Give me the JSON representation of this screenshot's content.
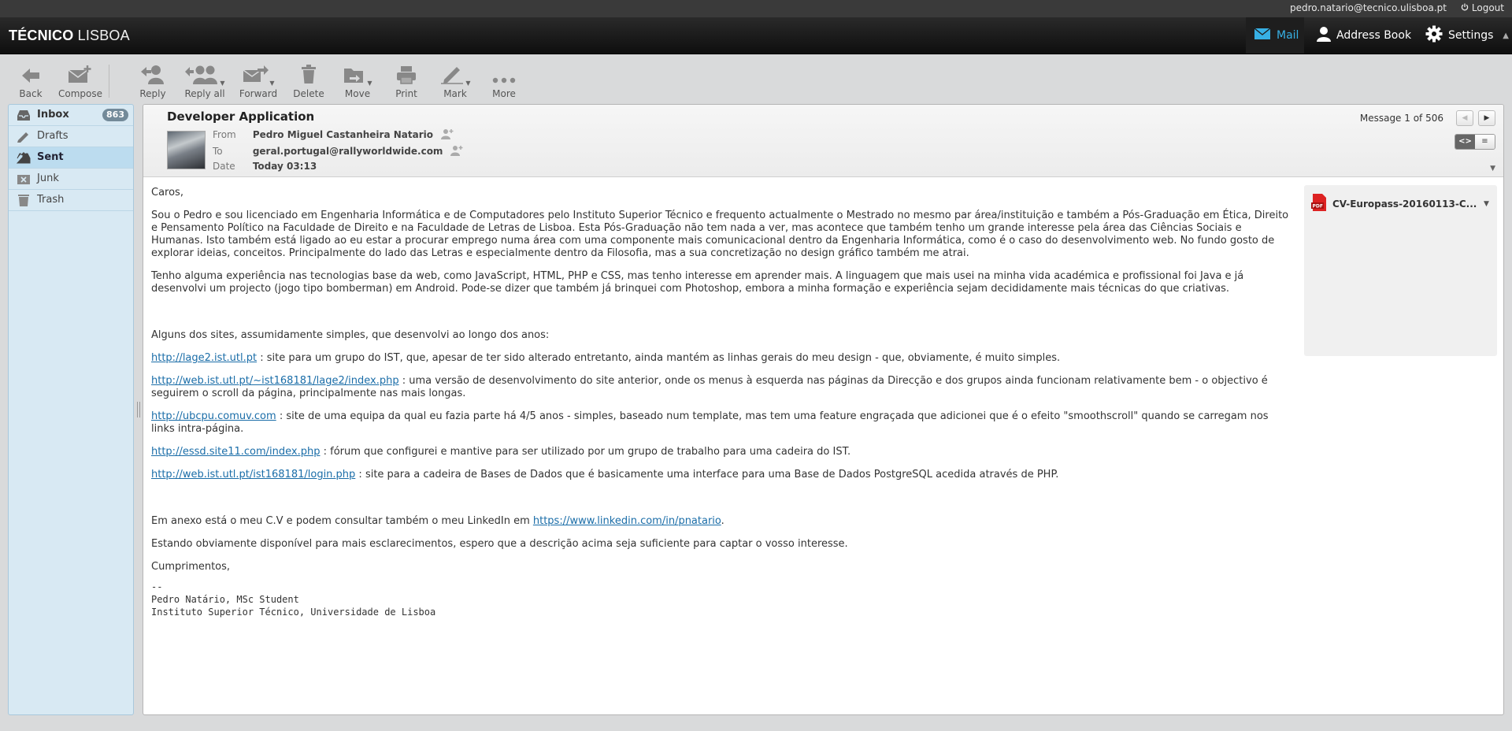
{
  "topbar": {
    "user_email": "pedro.natario@tecnico.ulisboa.pt",
    "logout_label": "Logout"
  },
  "header": {
    "logo_bold": "TÉCNICO",
    "logo_light": "LISBOA",
    "nav": {
      "mail": "Mail",
      "address_book": "Address Book",
      "settings": "Settings"
    }
  },
  "toolbar": {
    "back": "Back",
    "compose": "Compose",
    "reply": "Reply",
    "reply_all": "Reply all",
    "forward": "Forward",
    "delete": "Delete",
    "move": "Move",
    "print": "Print",
    "mark": "Mark",
    "more": "More"
  },
  "folders": {
    "inbox": {
      "label": "Inbox",
      "unread": "863"
    },
    "drafts": {
      "label": "Drafts"
    },
    "sent": {
      "label": "Sent"
    },
    "junk": {
      "label": "Junk"
    },
    "trash": {
      "label": "Trash"
    }
  },
  "message": {
    "subject": "Developer Application",
    "from_label": "From",
    "from": "Pedro Miguel Castanheira Natario",
    "to_label": "To",
    "to": "geral.portugal@rallyworldwide.com",
    "date_label": "Date",
    "date": "Today 03:13",
    "counter": "Message 1 of 506",
    "body": {
      "greeting": "Caros,",
      "p1": "Sou o Pedro e sou licenciado em Engenharia Informática e de Computadores pelo Instituto Superior Técnico e frequento actualmente o Mestrado no mesmo par área/instituição e também a Pós-Graduação em Ética, Direito e Pensamento Político na Faculdade de Direito e na Faculdade de Letras de Lisboa. Esta Pós-Graduação não tem nada a ver, mas acontece que também tenho um grande interesse pela área das Ciências Sociais e Humanas. Isto também está ligado ao eu estar a procurar emprego numa área com uma componente mais comunicacional dentro da Engenharia Informática, como é o caso do desenvolvimento web. No fundo gosto de explorar ideias, conceitos. Principalmente do lado das Letras e especialmente dentro da Filosofia, mas a sua concretização no design gráfico também me atrai.",
      "p2": "Tenho alguma experiência nas tecnologias base da web, como JavaScript, HTML, PHP e CSS, mas tenho interesse em aprender mais. A linguagem que mais usei na minha vida académica e profissional foi Java e já desenvolvi um projecto (jogo tipo bomberman) em Android. Pode-se dizer que também já brinquei com Photoshop, embora a minha formação e experiência sejam decididamente mais técnicas do que criativas.",
      "sites_intro": "Alguns dos sites, assumidamente simples, que desenvolvi ao longo dos anos:",
      "sites": [
        {
          "url": "http://lage2.ist.utl.pt",
          "desc": " : site para um grupo do IST, que, apesar de ter sido alterado entretanto, ainda mantém as linhas gerais do meu design - que, obviamente, é muito simples."
        },
        {
          "url": "http://web.ist.utl.pt/~ist168181/lage2/index.php",
          "desc": " : uma versão de desenvolvimento do site anterior, onde os menus à esquerda nas páginas da Direcção e dos grupos ainda funcionam relativamente bem - o objectivo é seguirem o scroll da página, principalmente nas mais longas."
        },
        {
          "url": "http://ubcpu.comuv.com",
          "desc": " : site de uma equipa da qual eu fazia parte há 4/5 anos - simples, baseado num template, mas tem uma feature engraçada que adicionei que é o efeito \"smoothscroll\" quando se carregam nos links intra-página."
        },
        {
          "url": "http://essd.site11.com/index.php",
          "desc": " : fórum que configurei e mantive para ser utilizado por um grupo de trabalho para uma cadeira do IST."
        },
        {
          "url": "http://web.ist.utl.pt/ist168181/login.php",
          "desc": " : site para a cadeira de Bases de Dados que é basicamente uma interface para uma Base de Dados PostgreSQL acedida através de PHP."
        }
      ],
      "annex_text": "Em anexo está o meu C.V e podem consultar também o meu LinkedIn em ",
      "linkedin_url": "https://www.linkedin.com/in/pnatario",
      "annex_end": ".",
      "closing_line": "Estando obviamente disponível para mais esclarecimentos, espero que a descrição acima seja suficiente para captar o vosso interesse.",
      "signoff": "Cumprimentos,",
      "signature": "--\nPedro Natário, MSc Student\nInstituto Superior Técnico, Universidade de Lisboa"
    },
    "attachment": {
      "name": "CV-Europass-20160113-C...",
      "type_badge": "PDF"
    }
  },
  "colors": {
    "accent": "#37b0e5",
    "folder_bg": "#d8e9f3",
    "link": "#1a6da8",
    "badge": "#738a99"
  }
}
